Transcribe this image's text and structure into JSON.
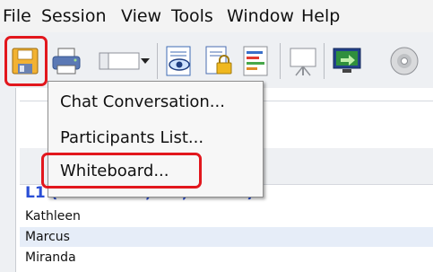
{
  "menubar": {
    "items": [
      "File",
      "Session",
      "View",
      "Tools",
      "Window",
      "Help"
    ]
  },
  "toolbar": {
    "icons": [
      "save-icon",
      "print-icon",
      "layout-dropdown-icon",
      "chevron-down-icon",
      "view-eye-icon",
      "secure-document-icon",
      "list-icon",
      "whiteboard-easel-icon",
      "presenter-screen-icon",
      "cd-disc-icon"
    ]
  },
  "dropdown": {
    "items": [
      "Chat Conversation...",
      "Participants List...",
      "Whiteboard..."
    ]
  },
  "participants": {
    "group_header": "L1 (Moderator, Me, Phone)",
    "names": [
      "Kathleen",
      "Marcus",
      "Miranda"
    ]
  },
  "colors": {
    "highlight": "#e2171d",
    "group_header": "#2a4fd6",
    "row_alt": "#e6edf8"
  }
}
